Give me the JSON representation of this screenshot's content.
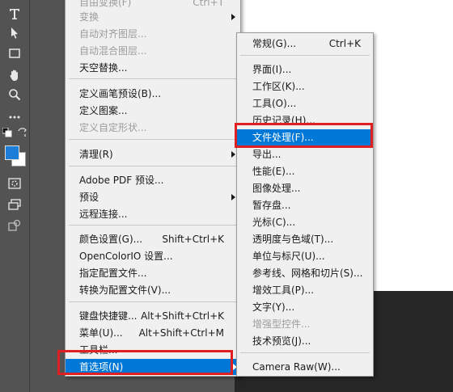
{
  "main_menu": {
    "items": [
      {
        "label": "自由变换(F)",
        "shortcut": "Ctrl+T",
        "disabled": true
      },
      {
        "label": "变换",
        "submenu": true,
        "disabled": true
      },
      {
        "label": "自动对齐图层...",
        "disabled": true
      },
      {
        "label": "自动混合图层...",
        "disabled": true
      },
      {
        "label": "天空替换..."
      },
      {
        "label": "定义画笔预设(B)..."
      },
      {
        "label": "定义图案..."
      },
      {
        "label": "定义自定形状...",
        "disabled": true
      },
      {
        "label": "清理(R)",
        "submenu": true
      },
      {
        "label": "Adobe PDF 预设..."
      },
      {
        "label": "预设",
        "submenu": true
      },
      {
        "label": "远程连接..."
      },
      {
        "label": "颜色设置(G)...",
        "shortcut": "Shift+Ctrl+K"
      },
      {
        "label": "OpenColorIO 设置..."
      },
      {
        "label": "指定配置文件..."
      },
      {
        "label": "转换为配置文件(V)..."
      },
      {
        "label": "键盘快捷键...",
        "shortcut": "Alt+Shift+Ctrl+K"
      },
      {
        "label": "菜单(U)...",
        "shortcut": "Alt+Shift+Ctrl+M"
      },
      {
        "label": "工具栏..."
      },
      {
        "label": "首选项(N)",
        "submenu": true
      }
    ]
  },
  "sub_menu": {
    "items": [
      {
        "label": "常规(G)...",
        "shortcut": "Ctrl+K"
      },
      {
        "label": "界面(I)..."
      },
      {
        "label": "工作区(K)..."
      },
      {
        "label": "工具(O)..."
      },
      {
        "label": "历史记录(H)..."
      },
      {
        "label": "文件处理(F)..."
      },
      {
        "label": "导出..."
      },
      {
        "label": "性能(E)..."
      },
      {
        "label": "图像处理..."
      },
      {
        "label": "暂存盘..."
      },
      {
        "label": "光标(C)..."
      },
      {
        "label": "透明度与色域(T)..."
      },
      {
        "label": "单位与标尺(U)..."
      },
      {
        "label": "参考线、网格和切片(S)..."
      },
      {
        "label": "增效工具(P)..."
      },
      {
        "label": "文字(Y)..."
      },
      {
        "label": "增强型控件...",
        "disabled": true
      },
      {
        "label": "技术预览(J)..."
      },
      {
        "label": "Camera Raw(W)..."
      }
    ]
  },
  "toolbar": {
    "tools": [
      "type-tool-icon",
      "path-selection-icon",
      "rectangle-tool-icon",
      "hand-tool-icon",
      "zoom-tool-icon",
      "more-tools-icon"
    ],
    "foreground_color": "#1c7ed6",
    "background_color": "#ffffff"
  },
  "colors": {
    "highlight": "#0078d7",
    "annotation": "#e02020"
  }
}
